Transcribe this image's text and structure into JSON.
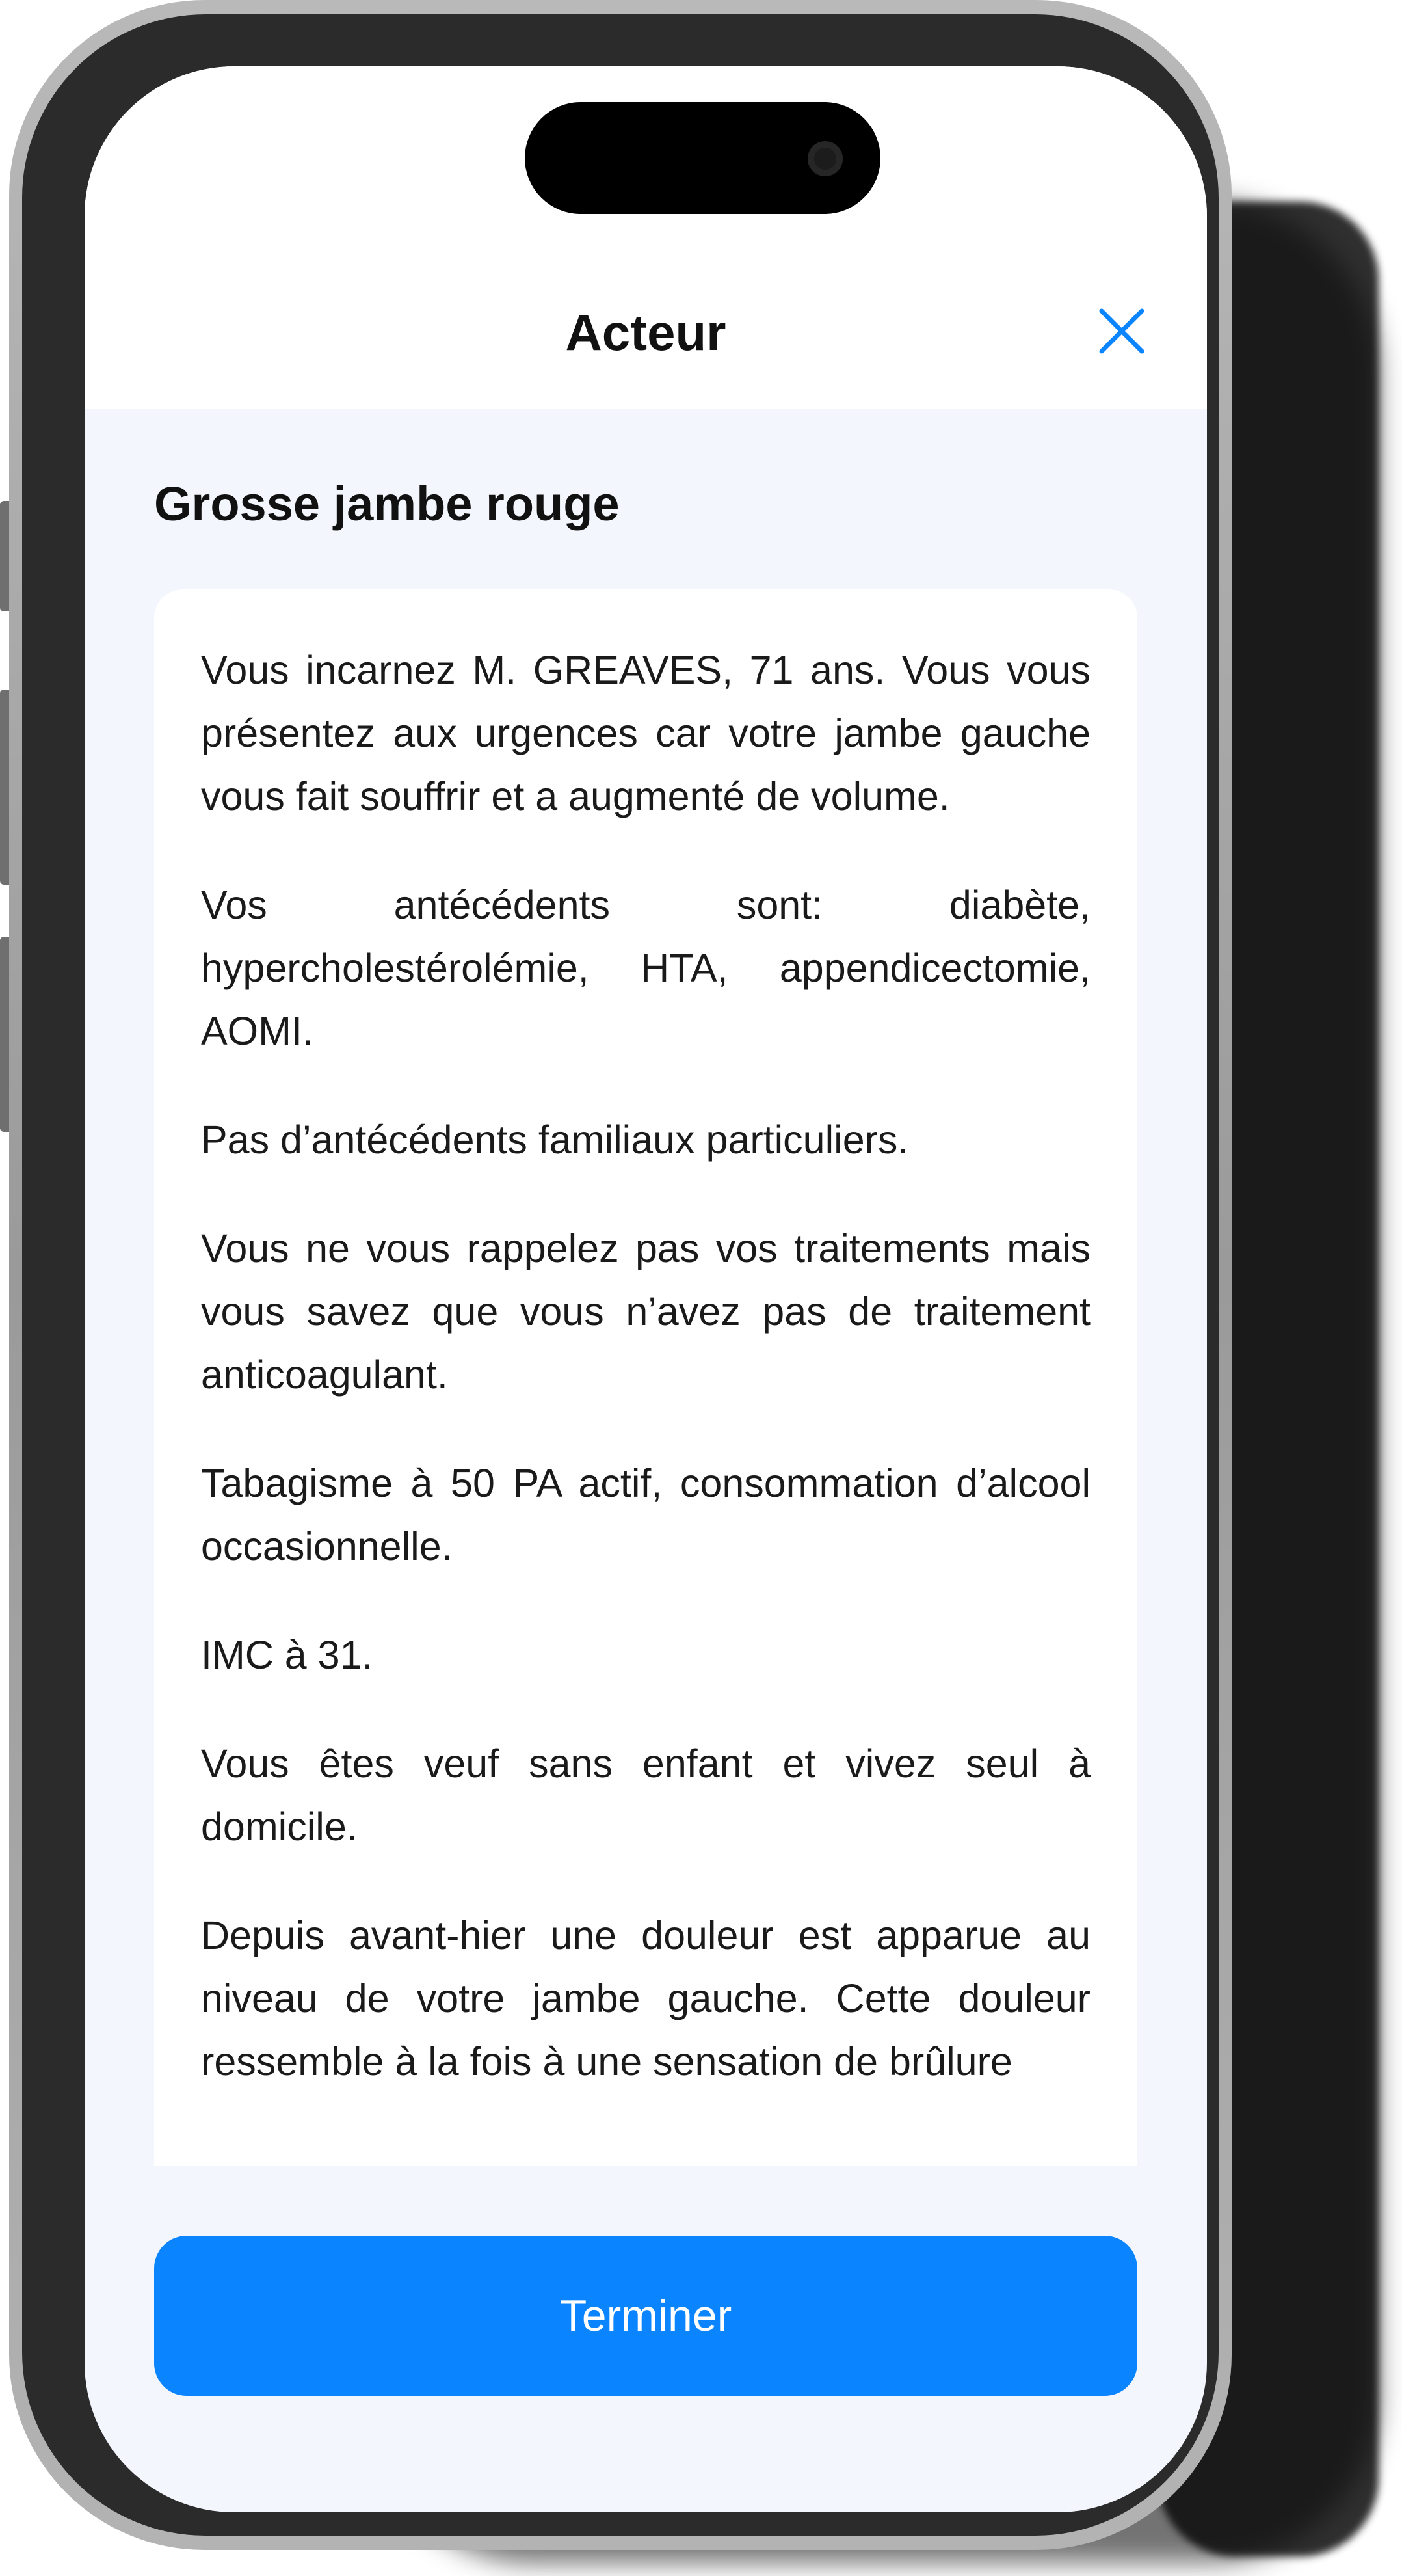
{
  "header": {
    "title": "Acteur",
    "close_icon": "close-icon",
    "accent_color": "#0a84ff"
  },
  "case": {
    "title": "Grosse jambe rouge",
    "paragraphs": [
      "Vous incarnez M. GREAVES, 71 ans. Vous vous présentez aux urgences car votre jambe gauche vous fait souffrir et a augmenté de volume.",
      "Vos antécédents sont: diabète, hypercholestérolémie, HTA, appendicectomie, AOMI.",
      "Pas d’antécédents familiaux particuliers.",
      "Vous ne vous rappelez pas vos traitements mais vous savez que vous n’avez pas de traitement anticoagulant.",
      "Tabagisme à 50 PA actif, consommation d’alcool occasionnelle.",
      "IMC à 31.",
      "Vous êtes veuf sans enfant et vivez seul à domicile.",
      "Depuis avant-hier une douleur est apparue au niveau de votre jambe gauche. Cette douleur ressemble à la fois à une sensation de brûlure"
    ]
  },
  "footer": {
    "finish_label": "Terminer"
  }
}
